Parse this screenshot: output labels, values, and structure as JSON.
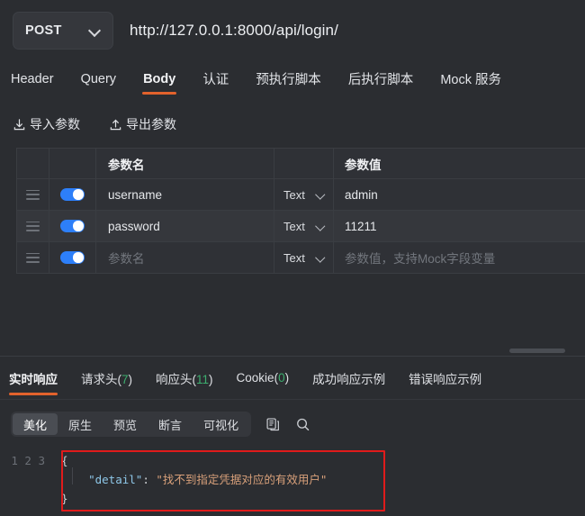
{
  "urlbar": {
    "method": "POST",
    "method_icon": "chevron-down-icon",
    "url": "http://127.0.0.1:8000/api/login/"
  },
  "request_tabs": [
    {
      "label": "Header",
      "active": false
    },
    {
      "label": "Query",
      "active": false
    },
    {
      "label": "Body",
      "active": true
    },
    {
      "label": "认证",
      "active": false
    },
    {
      "label": "预执行脚本",
      "active": false
    },
    {
      "label": "后执行脚本",
      "active": false
    },
    {
      "label": "Mock 服务",
      "active": false
    }
  ],
  "io_actions": [
    {
      "label": "导入参数",
      "icon": "download-icon"
    },
    {
      "label": "导出参数",
      "icon": "upload-icon"
    }
  ],
  "param_table": {
    "headers": {
      "name": "参数名",
      "value": "参数值"
    },
    "rows": [
      {
        "enabled": true,
        "name": "username",
        "type": "Text",
        "value": "admin",
        "name_placeholder": false,
        "value_placeholder": false,
        "highlighted": false
      },
      {
        "enabled": true,
        "name": "password",
        "type": "Text",
        "value": "11211",
        "name_placeholder": false,
        "value_placeholder": false,
        "highlighted": true
      },
      {
        "enabled": true,
        "name": "参数名",
        "type": "Text",
        "value": "参数值，支持Mock字段变量",
        "name_placeholder": true,
        "value_placeholder": true,
        "highlighted": false
      }
    ]
  },
  "response_tabs": [
    {
      "label": "实时响应",
      "count": null,
      "active": true
    },
    {
      "label": "请求头",
      "count": "7",
      "active": false
    },
    {
      "label": "响应头",
      "count": "11",
      "active": false
    },
    {
      "label": "Cookie",
      "count": "0",
      "active": false
    },
    {
      "label": "成功响应示例",
      "count": null,
      "active": false
    },
    {
      "label": "错误响应示例",
      "count": null,
      "active": false
    }
  ],
  "view_toolbar": {
    "segments": [
      {
        "label": "美化",
        "active": true
      },
      {
        "label": "原生",
        "active": false
      },
      {
        "label": "预览",
        "active": false
      },
      {
        "label": "断言",
        "active": false
      },
      {
        "label": "可视化",
        "active": false
      }
    ],
    "icons": [
      {
        "name": "copy-icon"
      },
      {
        "name": "search-icon"
      }
    ]
  },
  "code_viewer": {
    "line_numbers": "1\n2\n3",
    "open_brace": "{",
    "key": "\"detail\"",
    "colon": ": ",
    "string_value": "\"找不到指定凭据对应的有效用户\"",
    "close_brace": "}",
    "indent": "    "
  },
  "colors": {
    "accent": "#e2622c",
    "toggle_on": "#2d7ff9",
    "count_green": "#3cae6e",
    "annotation_red": "#e01b1b",
    "json_key": "#8ec7e8",
    "json_string": "#d8a07a",
    "background": "#2b2d31"
  }
}
